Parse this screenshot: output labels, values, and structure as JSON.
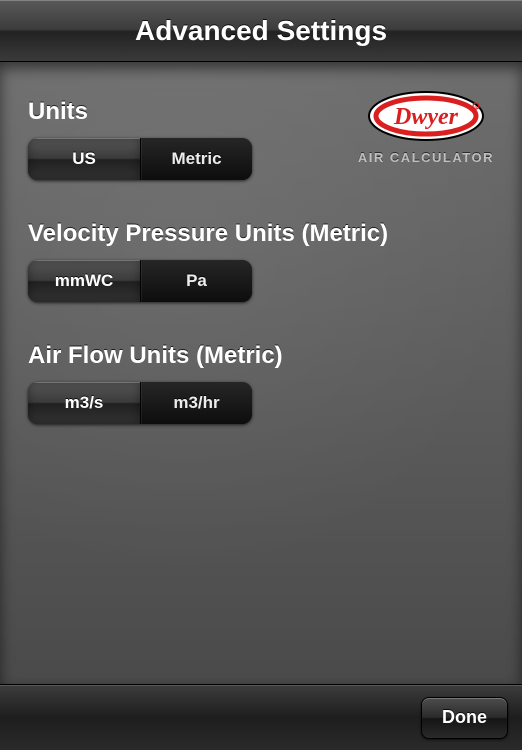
{
  "title": "Advanced Settings",
  "brand": {
    "name": "Dwyer",
    "subtitle": "AIR CALCULATOR",
    "accent": "#d91f1f"
  },
  "sections": {
    "units": {
      "label": "Units",
      "options": [
        "US",
        "Metric"
      ],
      "selected": 0
    },
    "velocity_pressure": {
      "label": "Velocity Pressure Units (Metric)",
      "options": [
        "mmWC",
        "Pa"
      ],
      "selected": 0
    },
    "air_flow": {
      "label": "Air Flow Units (Metric)",
      "options": [
        "m3/s",
        "m3/hr"
      ],
      "selected": 0
    }
  },
  "toolbar": {
    "done_label": "Done"
  }
}
